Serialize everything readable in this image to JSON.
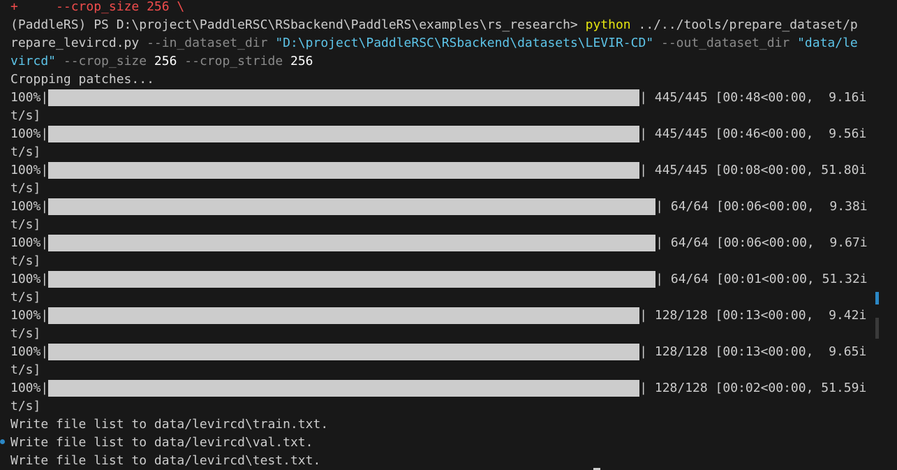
{
  "terminal": {
    "continuation_line": {
      "prompt": "+",
      "text": "--crop_size 256 \\"
    },
    "command": {
      "prompt": "(PaddleRS) PS D:\\project\\PaddleRSC\\RSbackend\\PaddleRS\\examples\\rs_research> ",
      "executable": "python",
      "line1_tail": " ../../tools/prepare_dataset/p",
      "line2_script": "repare_levircd.py",
      "line2_flag1": " --in_dataset_dir ",
      "line2_value1": "\"D:\\project\\PaddleRSC\\RSbackend\\datasets\\LEVIR-CD\"",
      "line2_flag2": " --out_dataset_dir ",
      "line2_value2a": "\"data/le",
      "line3_value2b": "vircd\"",
      "line3_flag3": " --crop_size ",
      "line3_value3": "256",
      "line3_flag4": " --crop_stride ",
      "line3_value4": "256"
    },
    "status_cropping": "Cropping patches...",
    "progress": [
      {
        "pct": "100%|",
        "bar_fill": 1.0,
        "suffix": "| 445/445 [00:48<00:00,  9.16i",
        "wrap": "t/s]"
      },
      {
        "pct": "100%|",
        "bar_fill": 1.0,
        "suffix": "| 445/445 [00:46<00:00,  9.56i",
        "wrap": "t/s]"
      },
      {
        "pct": "100%|",
        "bar_fill": 1.0,
        "suffix": "| 445/445 [00:08<00:00, 51.80i",
        "wrap": "t/s]"
      },
      {
        "pct": "100%|",
        "bar_fill": 1.0,
        "suffix": "| 64/64 [00:06<00:00,  9.38i",
        "wrap": "t/s]"
      },
      {
        "pct": "100%|",
        "bar_fill": 1.0,
        "suffix": "| 64/64 [00:06<00:00,  9.67i",
        "wrap": "t/s]"
      },
      {
        "pct": "100%|",
        "bar_fill": 1.0,
        "suffix": "| 64/64 [00:01<00:00, 51.32i",
        "wrap": "t/s]"
      },
      {
        "pct": "100%|",
        "bar_fill": 1.0,
        "suffix": "| 128/128 [00:13<00:00,  9.42i",
        "wrap": "t/s]"
      },
      {
        "pct": "100%|",
        "bar_fill": 1.0,
        "suffix": "| 128/128 [00:13<00:00,  9.65i",
        "wrap": "t/s]"
      },
      {
        "pct": "100%|",
        "bar_fill": 1.0,
        "suffix": "| 128/128 [00:02<00:00, 51.59i",
        "wrap": "t/s]"
      }
    ],
    "write_lines": [
      "Write file list to data/levircd\\train.txt.",
      "Write file list to data/levircd\\val.txt.",
      "Write file list to data/levircd\\test.txt."
    ]
  },
  "colors": {
    "background": "#181818",
    "text": "#cccccc",
    "command": "#e5e510",
    "string": "#5dc4e8",
    "flag": "#8a8a8a",
    "prompt_plus": "#f14c4c",
    "bar": "#cccccc",
    "accent": "#2b87c5"
  }
}
